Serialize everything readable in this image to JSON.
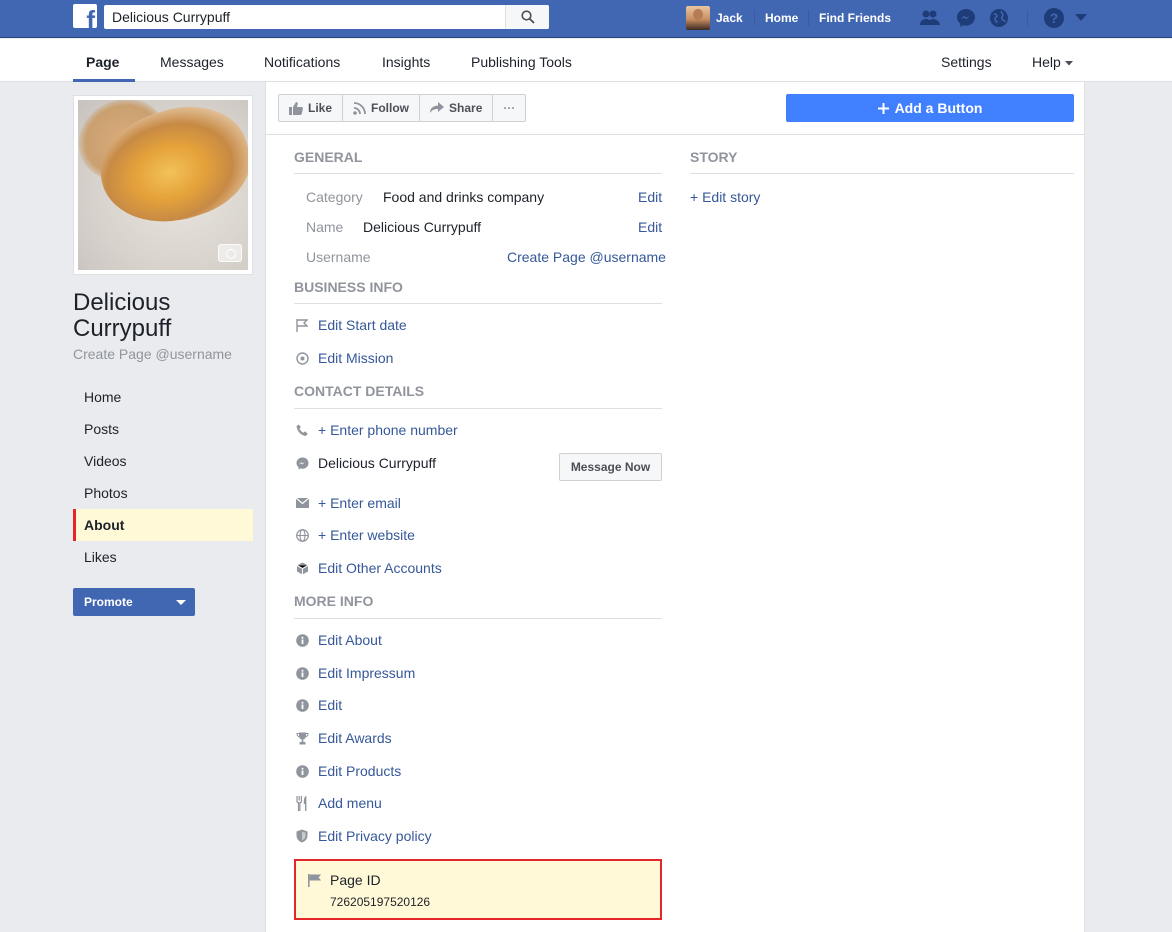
{
  "topbar": {
    "search_value": "Delicious Currypuff",
    "user_name": "Jack",
    "home_label": "Home",
    "find_friends_label": "Find Friends"
  },
  "page_tabs": {
    "page": "Page",
    "messages": "Messages",
    "notifications": "Notifications",
    "insights": "Insights",
    "publishing_tools": "Publishing Tools",
    "settings": "Settings",
    "help": "Help"
  },
  "left": {
    "page_name": "Delicious Currypuff",
    "username_prompt": "Create Page @username",
    "nav": [
      "Home",
      "Posts",
      "Videos",
      "Photos",
      "About",
      "Likes"
    ],
    "promote_label": "Promote"
  },
  "actions": {
    "like": "Like",
    "follow": "Follow",
    "share": "Share",
    "more": "···",
    "add_button": "Add a Button"
  },
  "general": {
    "title": "GENERAL",
    "category_label": "Category",
    "category_value": "Food and drinks company",
    "name_label": "Name",
    "name_value": "Delicious Currypuff",
    "username_label": "Username",
    "username_link": "Create Page @username",
    "edit": "Edit"
  },
  "business": {
    "title": "BUSINESS INFO",
    "start_date": "Edit Start date",
    "mission": "Edit Mission"
  },
  "contact": {
    "title": "CONTACT DETAILS",
    "phone": "+ Enter phone number",
    "messenger_name": "Delicious Currypuff",
    "message_now": "Message Now",
    "email": "+ Enter email",
    "website": "+ Enter website",
    "other_accounts": "Edit Other Accounts"
  },
  "more_info": {
    "title": "MORE INFO",
    "about": "Edit About",
    "impressum": "Edit Impressum",
    "edit": "Edit",
    "awards": "Edit Awards",
    "products": "Edit Products",
    "menu": "Add menu",
    "privacy": "Edit Privacy policy",
    "page_id_label": "Page ID",
    "page_id_value": "726205197520126"
  },
  "story": {
    "title": "STORY",
    "edit_story": "+ Edit story"
  }
}
